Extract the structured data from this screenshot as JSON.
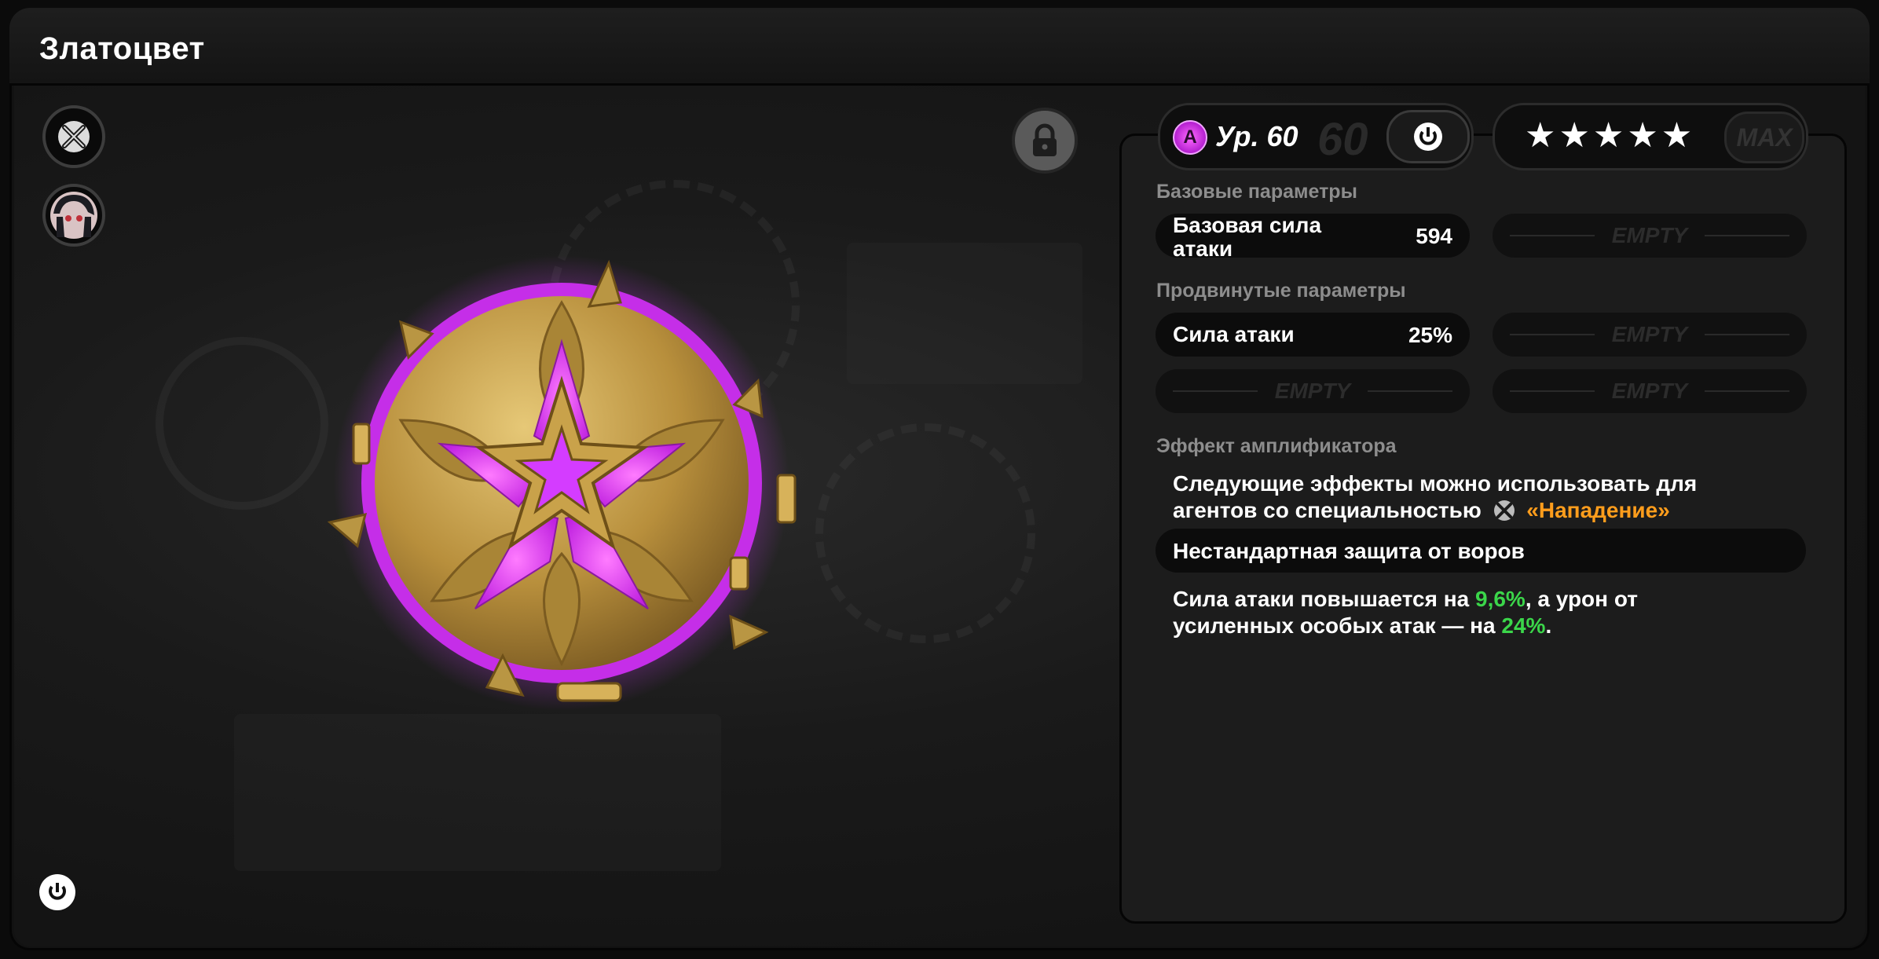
{
  "title": "Златоцвет",
  "level": {
    "badge": "A",
    "label": "Ур. 60",
    "max": "60"
  },
  "stars": "★★★★★",
  "max_label": "MAX",
  "base_section": "Базовые параметры",
  "base_stat": {
    "name_line1": "Базовая сила",
    "name_line2": "атаки",
    "value": "594"
  },
  "advanced_section": "Продвинутые параметры",
  "advanced_stat": {
    "name": "Сила атаки",
    "value": "25%"
  },
  "empty_label": "EMPTY",
  "effect_section": "Эффект амплификатора",
  "effect_desc": {
    "line1": "Следующие эффекты можно использовать для",
    "line2_prefix": "агентов со специальностью",
    "specialty": "«Нападение»"
  },
  "effect_name": "Нестандартная защита от воров",
  "effect_body": {
    "p1": "Сила атаки повышается на ",
    "v1": "9,6%",
    "p2": ", а урон от",
    "p3": "усиленных особых атак — на ",
    "v2": "24%",
    "p4": "."
  },
  "colors": {
    "accent_orange": "#ff9d1c",
    "accent_green": "#3bd64a",
    "disc_purple": "#d43cff",
    "disc_gold": "#c9a24a"
  },
  "icons": {
    "specialty": "crossed-swords-icon",
    "character": "character-avatar",
    "lock": "lock-icon",
    "level_action": "power-icon",
    "bottom": "power-icon"
  }
}
